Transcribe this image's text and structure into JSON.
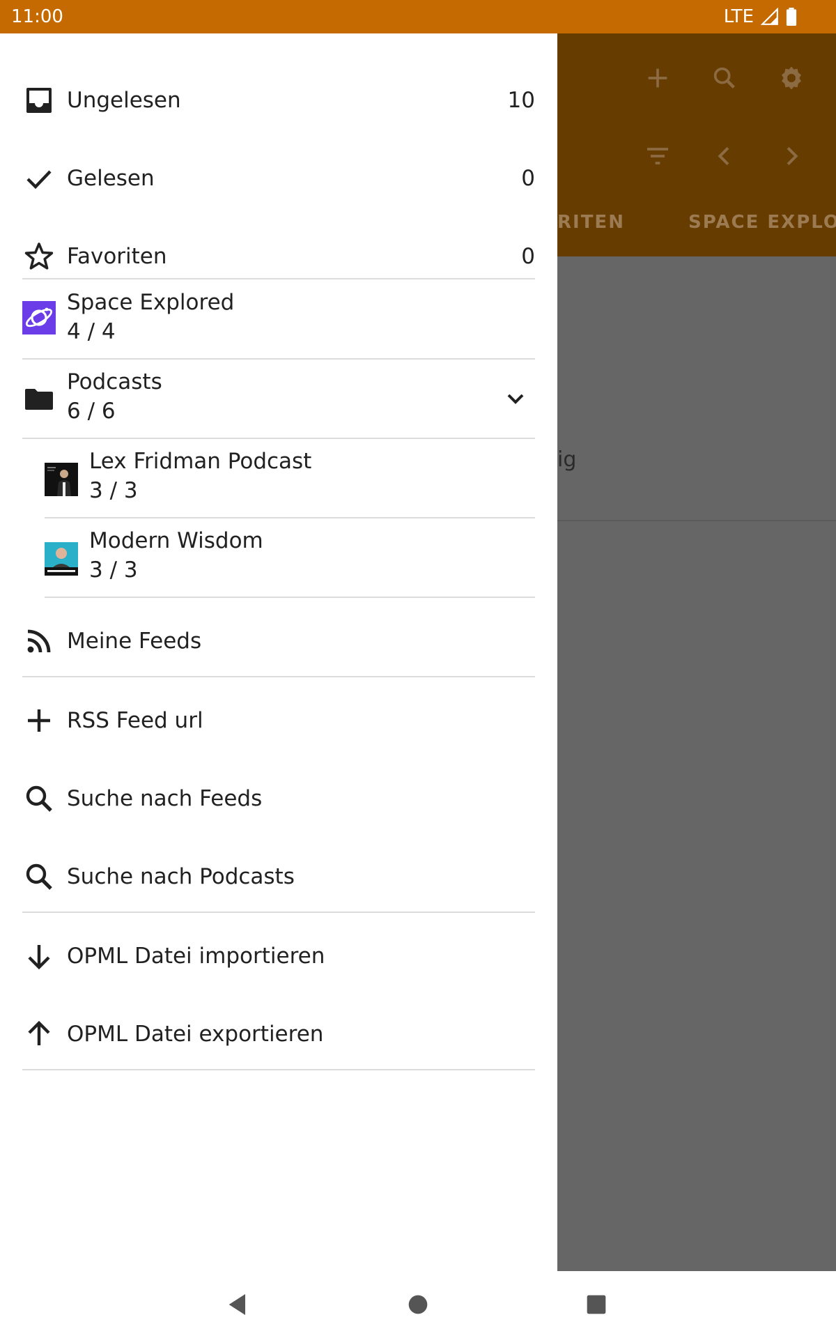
{
  "status_bar": {
    "time": "11:00",
    "network": "LTE"
  },
  "background_app": {
    "tabs": [
      "RITEN",
      "SPACE EXPLOR"
    ],
    "content_text": "ig",
    "icons": [
      "add-icon",
      "search-icon",
      "settings-icon",
      "filter-icon",
      "chevron-left-icon",
      "chevron-right-icon"
    ]
  },
  "drawer": {
    "top_items": [
      {
        "label": "Ungelesen",
        "count": "10",
        "icon": "inbox-icon"
      },
      {
        "label": "Gelesen",
        "count": "0",
        "icon": "check-icon"
      },
      {
        "label": "Favoriten",
        "count": "0",
        "icon": "star-outline-icon"
      }
    ],
    "feeds": [
      {
        "label": "Space Explored",
        "counts": "4 / 4",
        "icon": "space-explored-logo"
      },
      {
        "label": "Podcasts",
        "counts": "6 / 6",
        "icon": "folder-icon",
        "expanded": true
      },
      {
        "label": "Lex Fridman Podcast",
        "counts": "3 / 3",
        "icon": "lex-fridman-thumbnail"
      },
      {
        "label": "Modern Wisdom",
        "counts": "3 / 3",
        "icon": "modern-wisdom-thumbnail"
      }
    ],
    "my_feeds": {
      "label": "Meine Feeds",
      "icon": "rss-icon"
    },
    "actions": [
      {
        "label": "RSS Feed url",
        "icon": "add-icon"
      },
      {
        "label": "Suche nach Feeds",
        "icon": "search-icon"
      },
      {
        "label": "Suche nach Podcasts",
        "icon": "search-icon"
      }
    ],
    "opml": [
      {
        "label": "OPML Datei importieren",
        "icon": "arrow-down-icon"
      },
      {
        "label": "OPML Datei exportieren",
        "icon": "arrow-up-icon"
      }
    ]
  },
  "colors": {
    "status_bar": "#c56a00",
    "app_bar_dimmed": "#663c00",
    "scrim": "#666666",
    "space_explored_logo": "#6a3de8"
  }
}
